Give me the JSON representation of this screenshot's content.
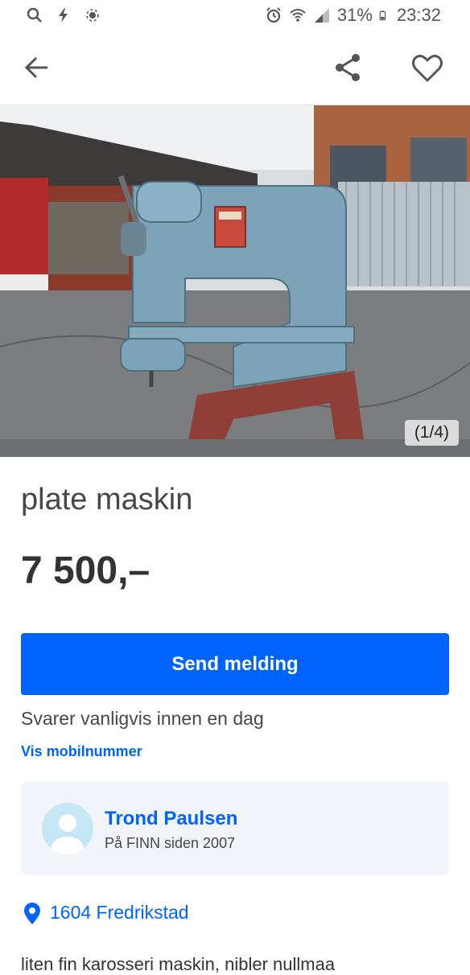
{
  "status_bar": {
    "battery": "31%",
    "time": "23:32"
  },
  "listing": {
    "image_counter": "(1/4)",
    "title": "plate maskin",
    "price": "7 500,–",
    "send_button": "Send melding",
    "reply_note": "Svarer vanligvis innen en dag",
    "show_mobile": "Vis mobilnummer",
    "description_partial": "liten fin karosseri maskin, nibler nullmaa"
  },
  "seller": {
    "name": "Trond Paulsen",
    "since": "På FINN siden 2007"
  },
  "location": {
    "text": "1604 Fredrikstad"
  },
  "colors": {
    "accent": "#0063fb",
    "seller_card_bg": "#f1f4f9",
    "avatar_bg": "#c4e6f5"
  },
  "icons": [
    "search-icon",
    "flash-icon",
    "location-sensor-icon",
    "alarm-icon",
    "wifi-icon",
    "signal-icon",
    "battery-icon",
    "back-arrow-icon",
    "share-icon",
    "heart-icon",
    "user-avatar-icon",
    "map-pin-icon"
  ]
}
